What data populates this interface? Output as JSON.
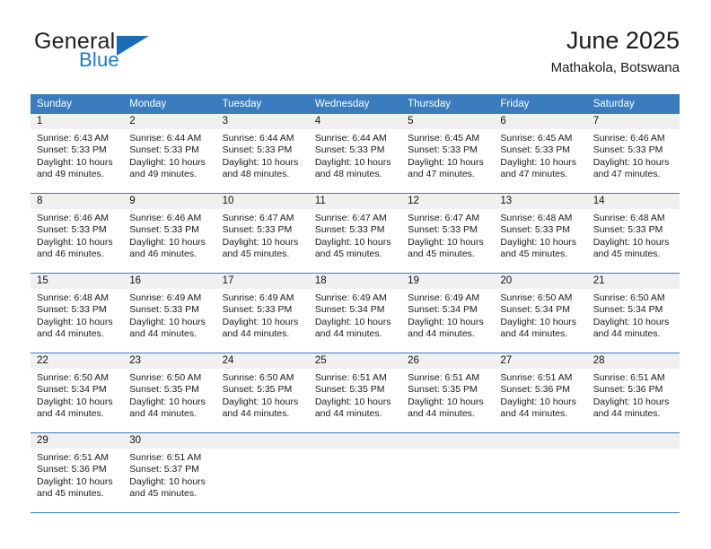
{
  "brand": {
    "word1": "General",
    "word2": "Blue",
    "logo_icon": "blue-triangle-logo",
    "accent_color": "#1b6cb5"
  },
  "header": {
    "title": "June 2025",
    "subtitle": "Mathakola, Botswana"
  },
  "calendar": {
    "header_color": "#3a7cbe",
    "daynum_band_color": "#f0f0f0",
    "weekdays": [
      "Sunday",
      "Monday",
      "Tuesday",
      "Wednesday",
      "Thursday",
      "Friday",
      "Saturday"
    ],
    "weeks": [
      [
        {
          "day": "1",
          "sunrise": "Sunrise: 6:43 AM",
          "sunset": "Sunset: 5:33 PM",
          "daylight1": "Daylight: 10 hours",
          "daylight2": "and 49 minutes."
        },
        {
          "day": "2",
          "sunrise": "Sunrise: 6:44 AM",
          "sunset": "Sunset: 5:33 PM",
          "daylight1": "Daylight: 10 hours",
          "daylight2": "and 49 minutes."
        },
        {
          "day": "3",
          "sunrise": "Sunrise: 6:44 AM",
          "sunset": "Sunset: 5:33 PM",
          "daylight1": "Daylight: 10 hours",
          "daylight2": "and 48 minutes."
        },
        {
          "day": "4",
          "sunrise": "Sunrise: 6:44 AM",
          "sunset": "Sunset: 5:33 PM",
          "daylight1": "Daylight: 10 hours",
          "daylight2": "and 48 minutes."
        },
        {
          "day": "5",
          "sunrise": "Sunrise: 6:45 AM",
          "sunset": "Sunset: 5:33 PM",
          "daylight1": "Daylight: 10 hours",
          "daylight2": "and 47 minutes."
        },
        {
          "day": "6",
          "sunrise": "Sunrise: 6:45 AM",
          "sunset": "Sunset: 5:33 PM",
          "daylight1": "Daylight: 10 hours",
          "daylight2": "and 47 minutes."
        },
        {
          "day": "7",
          "sunrise": "Sunrise: 6:46 AM",
          "sunset": "Sunset: 5:33 PM",
          "daylight1": "Daylight: 10 hours",
          "daylight2": "and 47 minutes."
        }
      ],
      [
        {
          "day": "8",
          "sunrise": "Sunrise: 6:46 AM",
          "sunset": "Sunset: 5:33 PM",
          "daylight1": "Daylight: 10 hours",
          "daylight2": "and 46 minutes."
        },
        {
          "day": "9",
          "sunrise": "Sunrise: 6:46 AM",
          "sunset": "Sunset: 5:33 PM",
          "daylight1": "Daylight: 10 hours",
          "daylight2": "and 46 minutes."
        },
        {
          "day": "10",
          "sunrise": "Sunrise: 6:47 AM",
          "sunset": "Sunset: 5:33 PM",
          "daylight1": "Daylight: 10 hours",
          "daylight2": "and 45 minutes."
        },
        {
          "day": "11",
          "sunrise": "Sunrise: 6:47 AM",
          "sunset": "Sunset: 5:33 PM",
          "daylight1": "Daylight: 10 hours",
          "daylight2": "and 45 minutes."
        },
        {
          "day": "12",
          "sunrise": "Sunrise: 6:47 AM",
          "sunset": "Sunset: 5:33 PM",
          "daylight1": "Daylight: 10 hours",
          "daylight2": "and 45 minutes."
        },
        {
          "day": "13",
          "sunrise": "Sunrise: 6:48 AM",
          "sunset": "Sunset: 5:33 PM",
          "daylight1": "Daylight: 10 hours",
          "daylight2": "and 45 minutes."
        },
        {
          "day": "14",
          "sunrise": "Sunrise: 6:48 AM",
          "sunset": "Sunset: 5:33 PM",
          "daylight1": "Daylight: 10 hours",
          "daylight2": "and 45 minutes."
        }
      ],
      [
        {
          "day": "15",
          "sunrise": "Sunrise: 6:48 AM",
          "sunset": "Sunset: 5:33 PM",
          "daylight1": "Daylight: 10 hours",
          "daylight2": "and 44 minutes."
        },
        {
          "day": "16",
          "sunrise": "Sunrise: 6:49 AM",
          "sunset": "Sunset: 5:33 PM",
          "daylight1": "Daylight: 10 hours",
          "daylight2": "and 44 minutes."
        },
        {
          "day": "17",
          "sunrise": "Sunrise: 6:49 AM",
          "sunset": "Sunset: 5:33 PM",
          "daylight1": "Daylight: 10 hours",
          "daylight2": "and 44 minutes."
        },
        {
          "day": "18",
          "sunrise": "Sunrise: 6:49 AM",
          "sunset": "Sunset: 5:34 PM",
          "daylight1": "Daylight: 10 hours",
          "daylight2": "and 44 minutes."
        },
        {
          "day": "19",
          "sunrise": "Sunrise: 6:49 AM",
          "sunset": "Sunset: 5:34 PM",
          "daylight1": "Daylight: 10 hours",
          "daylight2": "and 44 minutes."
        },
        {
          "day": "20",
          "sunrise": "Sunrise: 6:50 AM",
          "sunset": "Sunset: 5:34 PM",
          "daylight1": "Daylight: 10 hours",
          "daylight2": "and 44 minutes."
        },
        {
          "day": "21",
          "sunrise": "Sunrise: 6:50 AM",
          "sunset": "Sunset: 5:34 PM",
          "daylight1": "Daylight: 10 hours",
          "daylight2": "and 44 minutes."
        }
      ],
      [
        {
          "day": "22",
          "sunrise": "Sunrise: 6:50 AM",
          "sunset": "Sunset: 5:34 PM",
          "daylight1": "Daylight: 10 hours",
          "daylight2": "and 44 minutes."
        },
        {
          "day": "23",
          "sunrise": "Sunrise: 6:50 AM",
          "sunset": "Sunset: 5:35 PM",
          "daylight1": "Daylight: 10 hours",
          "daylight2": "and 44 minutes."
        },
        {
          "day": "24",
          "sunrise": "Sunrise: 6:50 AM",
          "sunset": "Sunset: 5:35 PM",
          "daylight1": "Daylight: 10 hours",
          "daylight2": "and 44 minutes."
        },
        {
          "day": "25",
          "sunrise": "Sunrise: 6:51 AM",
          "sunset": "Sunset: 5:35 PM",
          "daylight1": "Daylight: 10 hours",
          "daylight2": "and 44 minutes."
        },
        {
          "day": "26",
          "sunrise": "Sunrise: 6:51 AM",
          "sunset": "Sunset: 5:35 PM",
          "daylight1": "Daylight: 10 hours",
          "daylight2": "and 44 minutes."
        },
        {
          "day": "27",
          "sunrise": "Sunrise: 6:51 AM",
          "sunset": "Sunset: 5:36 PM",
          "daylight1": "Daylight: 10 hours",
          "daylight2": "and 44 minutes."
        },
        {
          "day": "28",
          "sunrise": "Sunrise: 6:51 AM",
          "sunset": "Sunset: 5:36 PM",
          "daylight1": "Daylight: 10 hours",
          "daylight2": "and 44 minutes."
        }
      ],
      [
        {
          "day": "29",
          "sunrise": "Sunrise: 6:51 AM",
          "sunset": "Sunset: 5:36 PM",
          "daylight1": "Daylight: 10 hours",
          "daylight2": "and 45 minutes."
        },
        {
          "day": "30",
          "sunrise": "Sunrise: 6:51 AM",
          "sunset": "Sunset: 5:37 PM",
          "daylight1": "Daylight: 10 hours",
          "daylight2": "and 45 minutes."
        },
        {
          "day": "",
          "sunrise": "",
          "sunset": "",
          "daylight1": "",
          "daylight2": ""
        },
        {
          "day": "",
          "sunrise": "",
          "sunset": "",
          "daylight1": "",
          "daylight2": ""
        },
        {
          "day": "",
          "sunrise": "",
          "sunset": "",
          "daylight1": "",
          "daylight2": ""
        },
        {
          "day": "",
          "sunrise": "",
          "sunset": "",
          "daylight1": "",
          "daylight2": ""
        },
        {
          "day": "",
          "sunrise": "",
          "sunset": "",
          "daylight1": "",
          "daylight2": ""
        }
      ]
    ]
  }
}
